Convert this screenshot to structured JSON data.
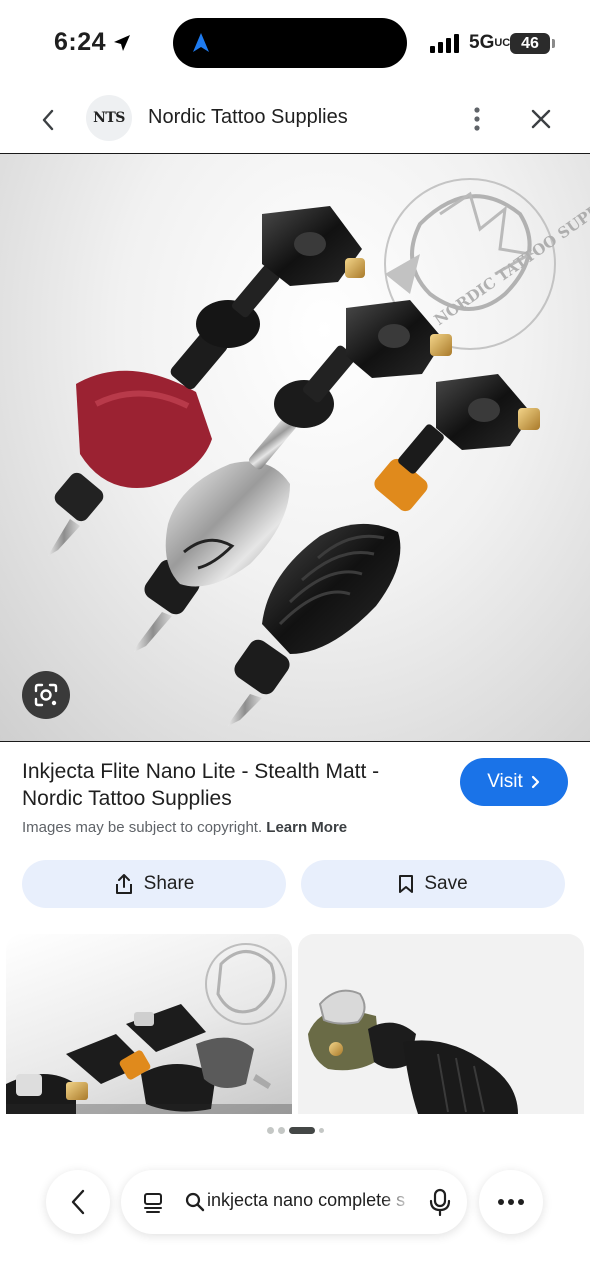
{
  "status_bar": {
    "time": "6:24",
    "network": "5G",
    "network_suffix": "UC",
    "battery": "46"
  },
  "header": {
    "site_logo": "NTS",
    "site_name": "Nordic Tattoo Supplies"
  },
  "main_image": {
    "watermark_text": "NORDIC TATTOO SUPPLIES"
  },
  "result": {
    "title_line1": "Inkjecta Flite Nano Lite - Stealth Matt -",
    "title_line2": "Nordic Tattoo Supplies",
    "visit_label": "Visit",
    "copyright_text": "Images may be subject to copyright.",
    "learn_more": "Learn More"
  },
  "actions": {
    "share_label": "Share",
    "save_label": "Save"
  },
  "search": {
    "query": "inkjecta nano complete s"
  },
  "colors": {
    "accent": "#1a73e8",
    "action_bg": "#e8effc",
    "grip_red": "#9b2232",
    "ring_orange": "#e08a1c"
  }
}
